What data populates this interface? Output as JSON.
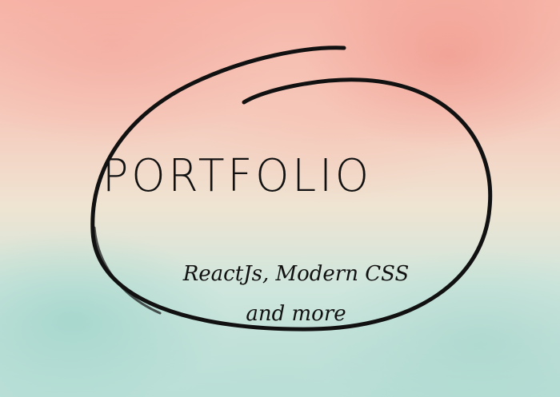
{
  "hero": {
    "title": "PORTFOLIO",
    "subtitle_line1": "ReactJs, Modern CSS",
    "subtitle_line2": "and more"
  },
  "colors": {
    "background_top": "#f6b5a8",
    "background_mid": "#efe4d2",
    "background_bottom": "#b9dfd7",
    "ink": "#111111"
  }
}
